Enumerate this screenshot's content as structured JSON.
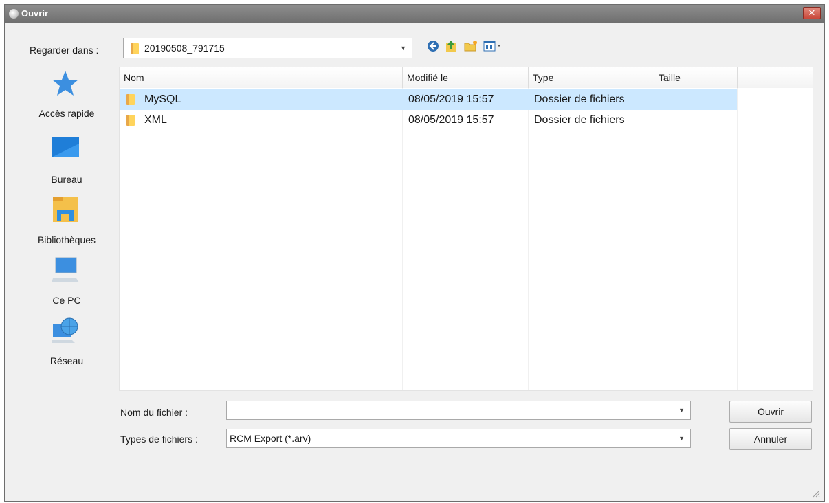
{
  "window": {
    "title": "Ouvrir",
    "close_label": "✕"
  },
  "lookin": {
    "label": "Regarder dans :",
    "value": "20190508_791715"
  },
  "toolbar": {
    "icons": [
      "back-icon",
      "up-folder-icon",
      "new-folder-icon",
      "view-menu-icon"
    ]
  },
  "places": [
    {
      "label": "Accès rapide",
      "icon": "star-icon"
    },
    {
      "label": "Bureau",
      "icon": "desktop-icon"
    },
    {
      "label": "Bibliothèques",
      "icon": "libraries-icon"
    },
    {
      "label": "Ce PC",
      "icon": "computer-icon"
    },
    {
      "label": "Réseau",
      "icon": "network-icon"
    }
  ],
  "filelist": {
    "columns": [
      "Nom",
      "Modifié le",
      "Type",
      "Taille"
    ],
    "rows": [
      {
        "name": "MySQL",
        "modified": "08/05/2019 15:57",
        "type": "Dossier de fichiers",
        "size": "",
        "selected": true
      },
      {
        "name": "XML",
        "modified": "08/05/2019 15:57",
        "type": "Dossier de fichiers",
        "size": "",
        "selected": false
      }
    ]
  },
  "filename": {
    "label": "Nom du fichier :",
    "value": ""
  },
  "filetype": {
    "label": "Types de fichiers :",
    "value": "RCM Export (*.arv)"
  },
  "buttons": {
    "open": "Ouvrir",
    "cancel": "Annuler"
  },
  "colors": {
    "selection": "#cce8ff",
    "titlebar": "#7f7f7f",
    "close": "#c9483a"
  }
}
